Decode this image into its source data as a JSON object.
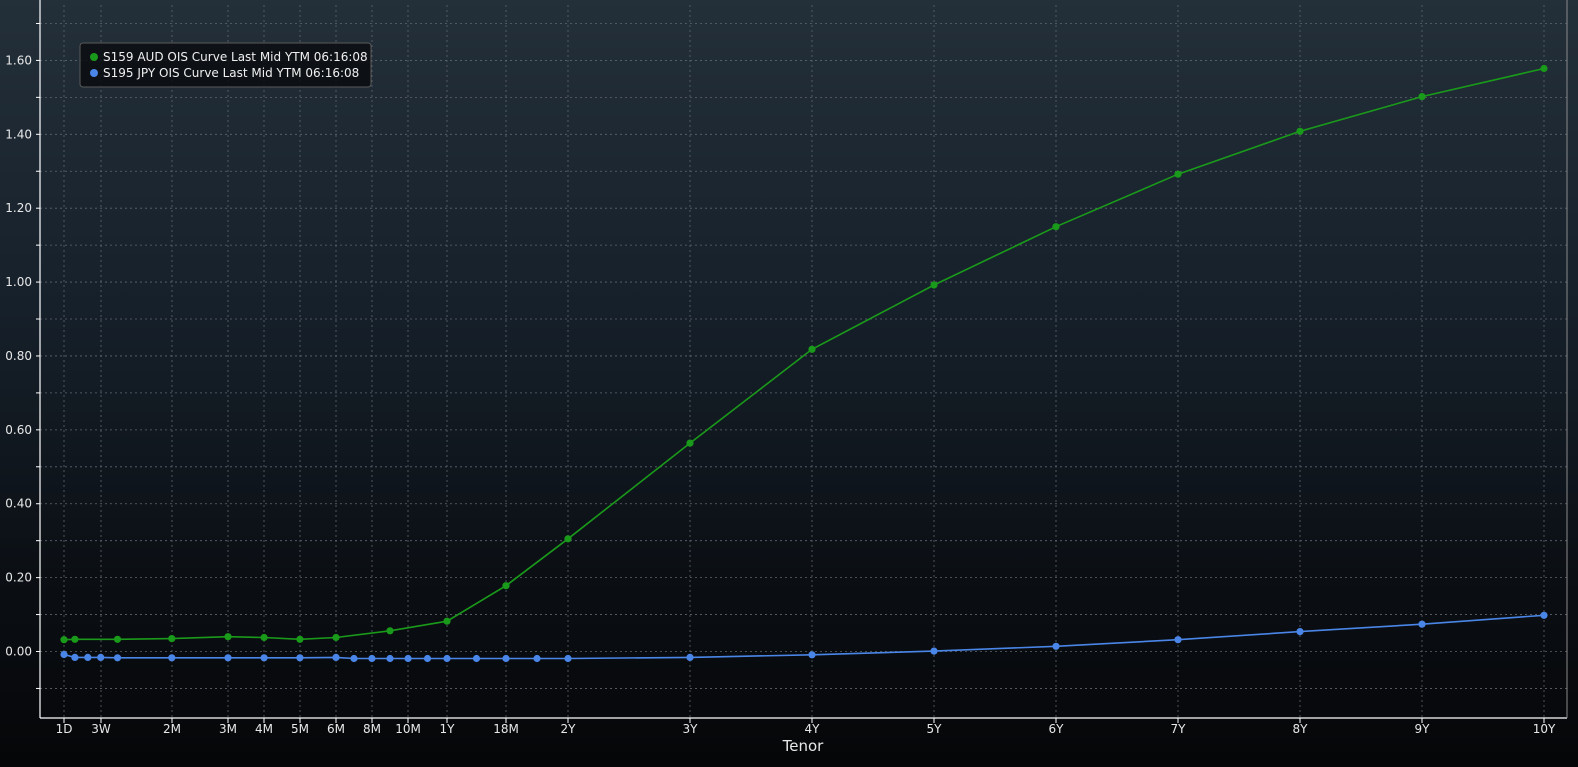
{
  "chart_data": {
    "type": "line",
    "xlabel": "Tenor",
    "ylabel": "",
    "ylim": [
      -0.18,
      1.75
    ],
    "yticks": [
      0.0,
      0.2,
      0.4,
      0.6,
      0.8,
      1.0,
      1.2,
      1.4,
      1.6
    ],
    "ytick_labels": [
      "0.00",
      "0.20",
      "0.40",
      "0.60",
      "0.80",
      "1.00",
      "1.20",
      "1.40",
      "1.60"
    ],
    "grid": true,
    "legend_position": "top-left",
    "x_tick_labels": [
      "1D",
      "3W",
      "2M",
      "3M",
      "4M",
      "5M",
      "6M",
      "8M",
      "10M",
      "1Y",
      "18M",
      "2Y",
      "3Y",
      "4Y",
      "5Y",
      "6Y",
      "7Y",
      "8Y",
      "9Y",
      "10Y"
    ],
    "x_tick_years": [
      0.003,
      0.058,
      0.167,
      0.25,
      0.333,
      0.417,
      0.5,
      0.667,
      0.833,
      1,
      1.5,
      2,
      3,
      4,
      5,
      6,
      7,
      8,
      9,
      10
    ],
    "series": [
      {
        "name": "S159 AUD OIS Curve Last Mid YTM 06:16:08",
        "color": "#1a9a1a",
        "x": [
          "1D",
          "1W",
          "2W",
          "3W",
          "1M",
          "2M",
          "3M",
          "4M",
          "5M",
          "6M",
          "7M",
          "8M",
          "9M",
          "10M",
          "11M",
          "1Y",
          "15M",
          "18M",
          "21M",
          "2Y",
          "3Y",
          "4Y",
          "5Y",
          "6Y",
          "7Y",
          "8Y",
          "9Y",
          "10Y"
        ],
        "values": [
          0.032,
          0.033,
          null,
          null,
          0.033,
          0.035,
          0.04,
          0.038,
          0.033,
          0.038,
          null,
          null,
          0.056,
          null,
          null,
          0.082,
          null,
          0.178,
          null,
          0.305,
          0.564,
          0.818,
          0.992,
          1.15,
          1.292,
          1.408,
          1.502,
          1.578
        ]
      },
      {
        "name": "S195 JPY OIS Curve Last Mid YTM 06:16:08",
        "color": "#4a86e8",
        "x": [
          "1D",
          "1W",
          "2W",
          "3W",
          "1M",
          "2M",
          "3M",
          "4M",
          "5M",
          "6M",
          "7M",
          "8M",
          "9M",
          "10M",
          "11M",
          "1Y",
          "15M",
          "18M",
          "21M",
          "2Y",
          "3Y",
          "4Y",
          "5Y",
          "6Y",
          "7Y",
          "8Y",
          "9Y",
          "10Y"
        ],
        "values": [
          -0.008,
          -0.016,
          -0.016,
          -0.016,
          -0.017,
          -0.017,
          -0.017,
          -0.017,
          -0.017,
          -0.016,
          -0.019,
          -0.019,
          -0.019,
          -0.019,
          -0.019,
          -0.019,
          -0.019,
          -0.019,
          -0.019,
          -0.019,
          -0.016,
          -0.009,
          0.001,
          0.014,
          0.032,
          0.054,
          0.074,
          0.098
        ]
      }
    ]
  }
}
